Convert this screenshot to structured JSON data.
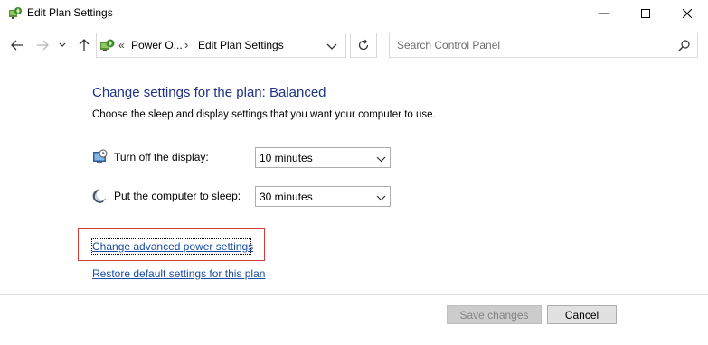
{
  "window": {
    "title": "Edit Plan Settings",
    "controls": [
      "minimize",
      "maximize",
      "close"
    ]
  },
  "address_bar": {
    "overflow_chevron": "«",
    "crumbs": [
      "Power O...",
      "Edit Plan Settings"
    ],
    "separator": "›"
  },
  "search": {
    "placeholder": "Search Control Panel"
  },
  "main": {
    "heading": "Change settings for the plan: Balanced",
    "subtext": "Choose the sleep and display settings that you want your computer to use.",
    "settings": [
      {
        "label": "Turn off the display:",
        "value": "10 minutes",
        "icon": "monitor-icon"
      },
      {
        "label": "Put the computer to sleep:",
        "value": "30 minutes",
        "icon": "sleep-moon-icon"
      }
    ],
    "links": {
      "advanced": "Change advanced power settings",
      "restore": "Restore default settings for this plan"
    }
  },
  "footer": {
    "save_label": "Save changes",
    "cancel_label": "Cancel"
  },
  "colors": {
    "heading": "#1e3287",
    "link": "#1a4da6",
    "highlight_border": "#d33b3b"
  }
}
